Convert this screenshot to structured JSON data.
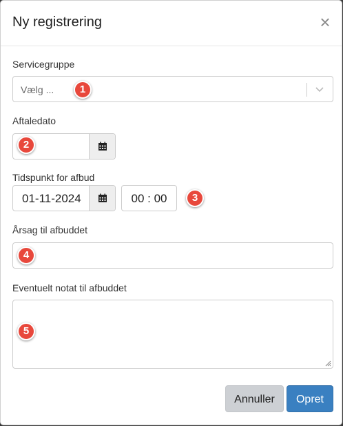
{
  "modal": {
    "title": "Ny registrering",
    "close_icon": "×"
  },
  "form": {
    "service_group": {
      "label": "Servicegruppe",
      "placeholder": "Vælg ..."
    },
    "appointment_date": {
      "label": "Aftaledato",
      "value": ""
    },
    "cancellation_time": {
      "label": "Tidspunkt for afbud",
      "date_value": "01-11-2024",
      "time_value": "00 : 00"
    },
    "reason": {
      "label": "Årsag til afbuddet",
      "value": ""
    },
    "note": {
      "label": "Eventuelt notat til afbuddet",
      "value": ""
    }
  },
  "badges": [
    "1",
    "2",
    "3",
    "4",
    "5"
  ],
  "footer": {
    "cancel_label": "Annuller",
    "create_label": "Opret"
  },
  "colors": {
    "badge": "#e8483c",
    "primary_button": "#3a80c1",
    "secondary_button": "#cdd0d4"
  },
  "icons": {
    "close": "close-icon",
    "chevron": "chevron-down-icon",
    "calendar": "calendar-icon"
  }
}
